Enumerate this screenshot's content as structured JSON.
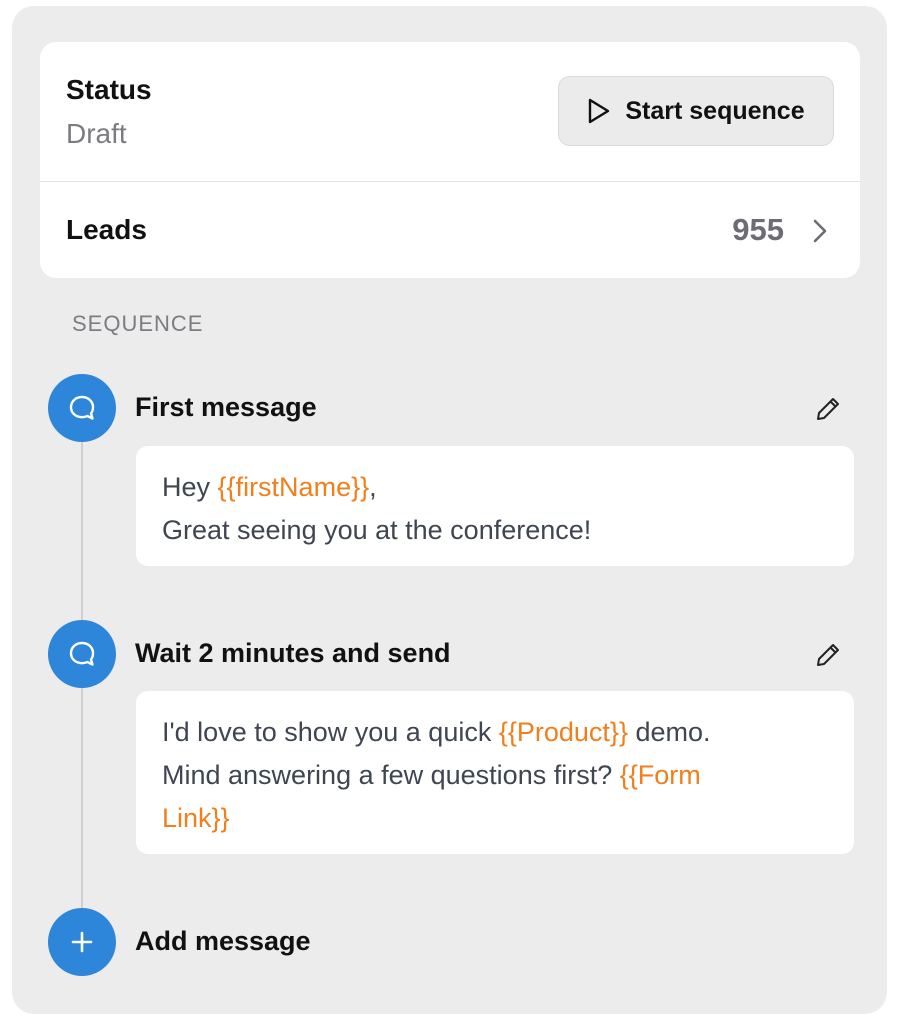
{
  "status": {
    "label": "Status",
    "value": "Draft",
    "start_button_label": "Start sequence",
    "start_button_icon": "play-icon"
  },
  "leads": {
    "label": "Leads",
    "count": "955",
    "chevron_icon": "chevron-right-icon"
  },
  "section_label": "SEQUENCE",
  "steps": [
    {
      "title": "First message",
      "icon": "chat-bubble-icon",
      "edit_icon": "pencil-icon",
      "message": {
        "line1_prefix": "Hey ",
        "line1_var": "{{firstName}}",
        "line1_suffix": ",",
        "line2": "Great seeing you at the conference!"
      }
    },
    {
      "title": "Wait 2 minutes and send",
      "icon": "chat-bubble-icon",
      "edit_icon": "pencil-icon",
      "message": {
        "line1_prefix": "I'd love to show you a quick ",
        "line1_var": "{{Product}}",
        "line1_suffix": " demo.",
        "line2_prefix": "Mind answering a few questions first? ",
        "line2_var_a": "{{Form",
        "line3_var_b": "Link}}"
      }
    }
  ],
  "add_message_label": "Add message",
  "colors": {
    "accent_blue": "#2d86d9",
    "variable_orange": "#f07f1c",
    "panel_bg": "#ececed"
  }
}
